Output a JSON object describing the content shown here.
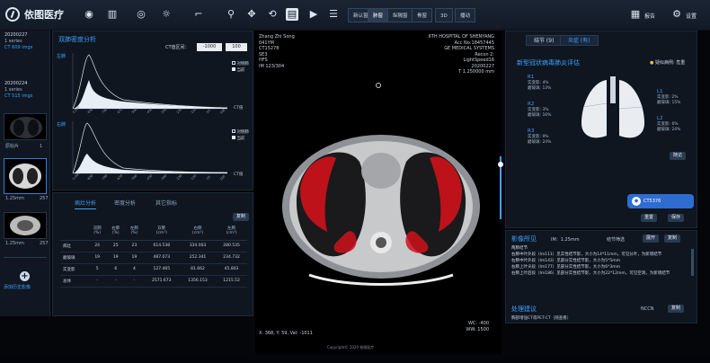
{
  "app": {
    "name": "依图医疗"
  },
  "toolbar": {
    "tabs": [
      "新认窗",
      "肺窗",
      "纵隔窗",
      "骨窗",
      "3D",
      "播动"
    ],
    "active_tab": 1,
    "report_label": "报告",
    "settings_label": "设置"
  },
  "series": [
    {
      "date": "20200227",
      "series": "1 series",
      "count": "CT 609 imgs",
      "thumb_label": "",
      "thumb_count": ""
    },
    {
      "date": "20200224",
      "series": "1 series",
      "count": "CT 515 imgs",
      "thumb_label": "原始片",
      "thumb_count": "1"
    },
    {
      "date": "",
      "series": "",
      "count": "",
      "thumb_label": "1.25mm",
      "thumb_count": "257"
    },
    {
      "date": "",
      "series": "",
      "count": "",
      "thumb_label": "1.25mm",
      "thumb_count": "257"
    }
  ],
  "add_series_label": "添加历史影像",
  "lung_panel": {
    "title": "双肺密度分析",
    "ct_range_label": "CT值区间：",
    "ct_min": "-1000",
    "ct_max": "100",
    "left_label": "左肺",
    "right_label": "右肺",
    "legend": [
      "对侧肺",
      "当前"
    ],
    "ct_axis_label": "CT值",
    "x_ticks": [
      "-1,000",
      "-830",
      "-780",
      "-670",
      "-560",
      "-450",
      "-340",
      "-230",
      "-120",
      "-10",
      "100"
    ],
    "color_accent": "#3fa0ff"
  },
  "analysis": {
    "tabs": [
      "病灶分析",
      "密度分析",
      "其它指标"
    ],
    "export_label": "复制",
    "columns": [
      "",
      "双肺\n(%)",
      "右肺\n(%)",
      "左肺\n(%)",
      "双肺\n(cm³)",
      "右肺\n(cm³)",
      "左肺\n(cm³)"
    ],
    "rows": [
      [
        "病灶",
        "24",
        "25",
        "23",
        "614.538",
        "334.003",
        "280.535"
      ],
      [
        "磨玻璃",
        "19",
        "19",
        "19",
        "487.073",
        "252.341",
        "234.732"
      ],
      [
        "实变影",
        "5",
        "6",
        "4",
        "127.465",
        "81.662",
        "45.803"
      ],
      [
        "总体",
        "-",
        "-",
        "-",
        "2571.673",
        "1356.153",
        "1215.52"
      ]
    ]
  },
  "viewer": {
    "patient_name": "Zhang Zhi Song",
    "age": "041YM",
    "id": "CT15278",
    "series": "SE3",
    "position": "HFS",
    "image_num": "IM 123/304",
    "hospital": "6TH HOSPITAL OF SHENYANG",
    "acc": "Acc No:18457445",
    "manufacturer": "GE MEDICAL SYSTEMS",
    "recon": "Recon 2:",
    "model": "LightSpeed16",
    "date": "20200227",
    "thickness": "T 1.250000 mm",
    "coords": "X: 368, Y: 59, Val: -1011",
    "wc": "WC: -400",
    "ww": "WW: 1500",
    "copyright": "Copyright© 2020 依图医疗"
  },
  "right_panel": {
    "tabs": [
      "结节 (9)",
      "炎症 (有)"
    ],
    "title": "新型冠状病毒肺炎评估",
    "tag": "疑似病例: 危重",
    "regions": [
      {
        "name": "R1",
        "l1": "实变影: 4%",
        "l2": "磨玻璃: 13%"
      },
      {
        "name": "R2",
        "l1": "实变影: 3%",
        "l2": "磨玻璃: 16%"
      },
      {
        "name": "R3",
        "l1": "实变影: 9%",
        "l2": "磨玻璃: 24%"
      },
      {
        "name": "L1",
        "l1": "实变影: 2%",
        "l2": "磨玻璃: 15%"
      },
      {
        "name": "L2",
        "l1": "实变影: 6%",
        "l2": "磨玻璃: 24%"
      }
    ],
    "detail_label": "随访",
    "ct_id": "CT5376",
    "buttons": [
      "重置",
      "保存"
    ]
  },
  "findings": {
    "title": "影像所见",
    "im_label": "IM：1.25mm",
    "type_label": "结节筛选",
    "expand": "展开",
    "copy": "复制",
    "text": [
      "两肺结节",
      "右肺中叶外段（Im111）见实性结节影，大小为14*11mm，可见分叶，为新增结节",
      "右肺中叶外段（Im143）见部分实性结节影，大小为5*5mm",
      "右肺上叶尖段（Im177）见部分实性结节影，大小为6*3mm",
      "右肺上叶后段（Im186）见部分实性结节影，大小为22*12mm，可见空洞，为新增结节"
    ],
    "suggestion_title": "处理建议",
    "suggestion_select": "NCCN",
    "suggestion": "胸部增强CT或PET-CT（随查看）",
    "suggestion_copy": "复制"
  }
}
